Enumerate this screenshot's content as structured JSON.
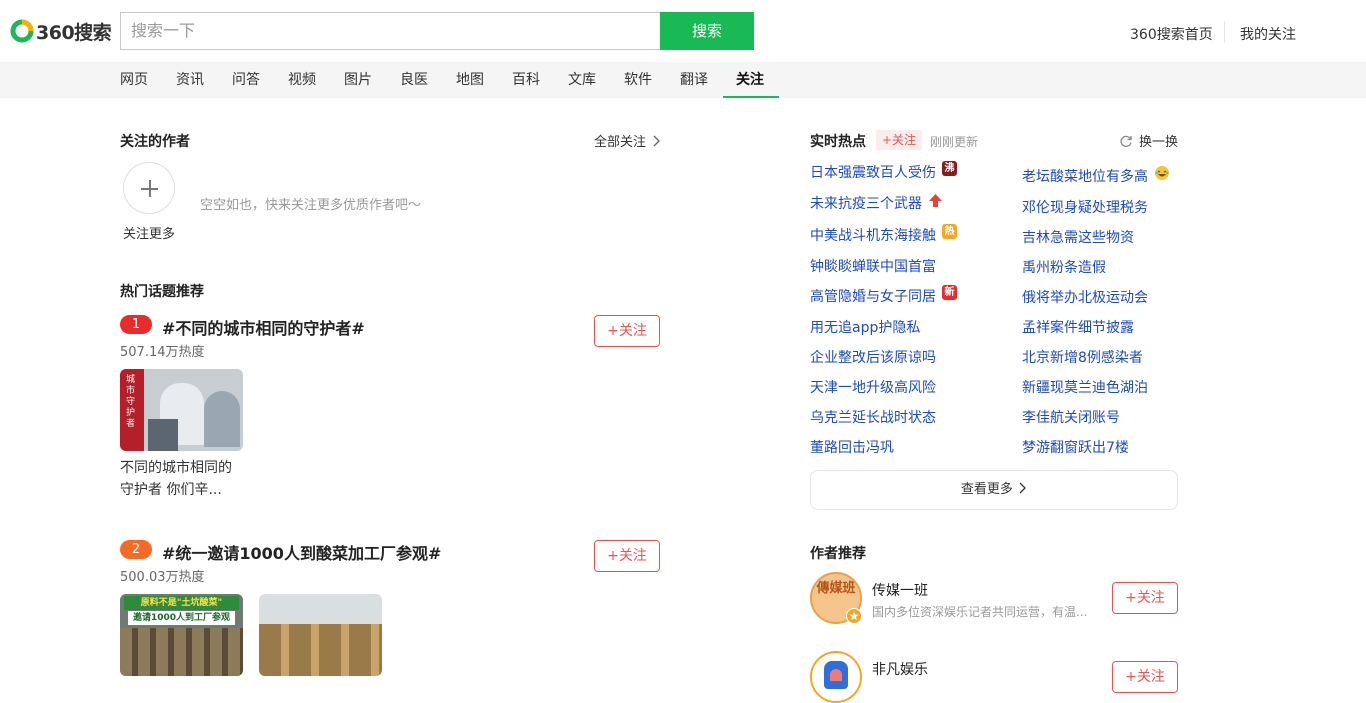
{
  "header": {
    "logo_text": "360搜索",
    "search_placeholder": "搜索一下",
    "search_button": "搜索",
    "home_link": "360搜索首页",
    "my_follow_link": "我的关注"
  },
  "nav": {
    "tabs": [
      "网页",
      "资讯",
      "问答",
      "视频",
      "图片",
      "良医",
      "地图",
      "百科",
      "文库",
      "软件",
      "翻译",
      "关注"
    ],
    "active": "关注"
  },
  "followed_authors": {
    "title": "关注的作者",
    "all_link": "全部关注",
    "add_more": "关注更多",
    "empty_text": "空空如也，快来关注更多优质作者吧～"
  },
  "hot_topics": {
    "title": "热门话题推荐",
    "items": [
      {
        "rank": "1",
        "title": "#不同的城市相同的守护者#",
        "heat": "507.14万热度",
        "follow": "+关注",
        "caption_line1": "不同的城市相同的",
        "caption_line2": "守护者 你们辛..."
      },
      {
        "rank": "2",
        "title": "#统一邀请1000人到酸菜加工厂参观#",
        "heat": "500.03万热度",
        "follow": "+关注"
      }
    ],
    "thumb_text": {
      "city_vertical": "城市守护者",
      "pickle_line1": "原料不是\"土坑酸菜\"",
      "pickle_line2": "邀请1000人到工厂参观"
    }
  },
  "realtime": {
    "title": "实时热点",
    "follow_tag": "+关注",
    "updated": "刚刚更新",
    "refresh": "换一换",
    "left": [
      {
        "text": "日本强震致百人受伤",
        "badge": "沸"
      },
      {
        "text": "未来抗疫三个武器",
        "badge": "up"
      },
      {
        "text": "中美战斗机东海接触",
        "badge": "热"
      },
      {
        "text": "钟睒睒蝉联中国首富",
        "badge": ""
      },
      {
        "text": "高管隐婚与女子同居",
        "badge": "新"
      },
      {
        "text": "用无追app护隐私",
        "badge": ""
      },
      {
        "text": "企业整改后该原谅吗",
        "badge": ""
      },
      {
        "text": "天津一地升级高风险",
        "badge": ""
      },
      {
        "text": "乌克兰延长战时状态",
        "badge": ""
      },
      {
        "text": "董路回击冯巩",
        "badge": ""
      }
    ],
    "right": [
      {
        "text": "老坛酸菜地位有多高",
        "badge": "emoji"
      },
      {
        "text": "邓伦现身疑处理税务",
        "badge": ""
      },
      {
        "text": "吉林急需这些物资",
        "badge": ""
      },
      {
        "text": "禹州粉条造假",
        "badge": ""
      },
      {
        "text": "俄将举办北极运动会",
        "badge": ""
      },
      {
        "text": "孟祥案件细节披露",
        "badge": ""
      },
      {
        "text": "北京新增8例感染者",
        "badge": ""
      },
      {
        "text": "新疆现莫兰迪色湖泊",
        "badge": ""
      },
      {
        "text": "李佳航关闭账号",
        "badge": ""
      },
      {
        "text": "梦游翻窗跃出7楼",
        "badge": ""
      }
    ],
    "more": "查看更多"
  },
  "authors": {
    "title": "作者推荐",
    "items": [
      {
        "name": "传媒一班",
        "desc": "国内多位资深娱乐记者共同运营，有温...",
        "follow": "+关注",
        "avatar_text": "傳媒班"
      },
      {
        "name": "非凡娱乐",
        "desc": "",
        "follow": "+关注"
      }
    ]
  },
  "colors": {
    "green": "#19b955",
    "red": "#e85454",
    "link_blue": "#1e4bbd",
    "rank_orange": "#f56a26"
  }
}
